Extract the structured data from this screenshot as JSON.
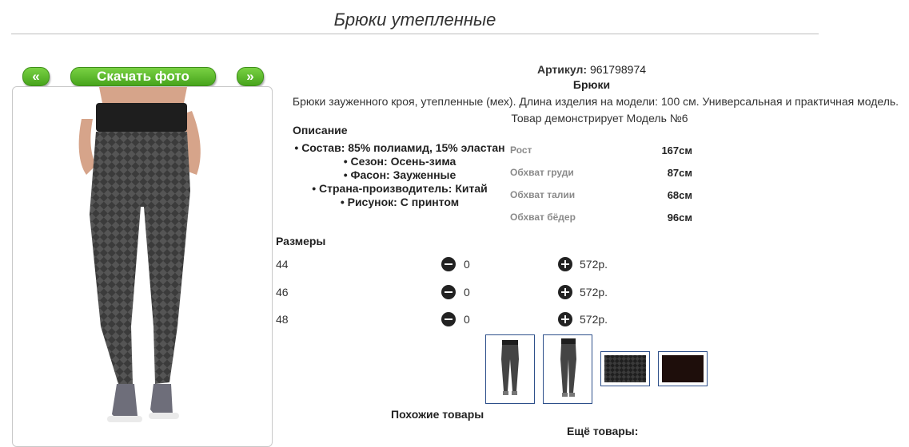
{
  "page": {
    "title": "Брюки утепленные"
  },
  "nav": {
    "prev_label": "«",
    "download_label": "Скачать фото",
    "next_label": "»"
  },
  "product": {
    "article_label": "Артикул:",
    "article_value": "961798974",
    "name": "Брюки",
    "description": "Брюки зауженного кроя, утепленные (мех). Длина изделия на модели: 100 см. Универсальная и практичная модель.",
    "model_note": "Товар демонстрирует Модель №6"
  },
  "description": {
    "heading": "Описание",
    "features": [
      "Состав: 85% полиамид, 15% эластан",
      "Сезон: Осень-зима",
      "Фасон: Зауженные",
      "Страна-производитель: Китай",
      "Рисунок: С принтом"
    ]
  },
  "model_params": [
    {
      "label": "Рост",
      "value": "167см"
    },
    {
      "label": "Обхват груди",
      "value": "87см"
    },
    {
      "label": "Обхват талии",
      "value": "68см"
    },
    {
      "label": "Обхват бёдер",
      "value": "96см"
    }
  ],
  "sizes": {
    "heading": "Размеры",
    "rows": [
      {
        "size": "44",
        "qty": "0",
        "price": "572р."
      },
      {
        "size": "46",
        "qty": "0",
        "price": "572р."
      },
      {
        "size": "48",
        "qty": "0",
        "price": "572р."
      }
    ]
  },
  "footer": {
    "similar_label": "Похожие товары",
    "more_label": "Ещё товары:"
  },
  "colors": {
    "accent_green": "#47a41c",
    "thumb_border": "#2d4f8a"
  },
  "icons": [
    "minus-circle-icon",
    "plus-circle-icon"
  ]
}
